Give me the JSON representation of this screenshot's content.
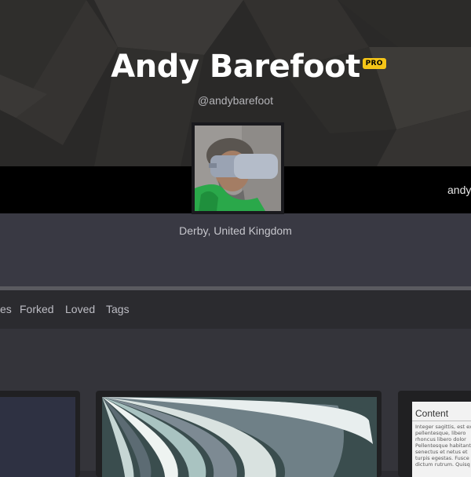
{
  "profile": {
    "name": "Andy Barefoot",
    "badge": "PRO",
    "handle": "@andybarefoot",
    "location": "Derby, United Kingdom",
    "bar_right_text": "andy"
  },
  "tabs": [
    {
      "label": "es"
    },
    {
      "label": "Forked"
    },
    {
      "label": "Loved"
    },
    {
      "label": "Tags"
    }
  ],
  "cards": {
    "third": {
      "title": "Content",
      "text": "Integer sagittis, est ex pellentesque, libero rhoncus libero dolor Pellentesque habitant senectus et netus et turpis egestas. Fusce dictum rutrum. Quisq"
    }
  },
  "icons": {
    "avatar": "user-avatar-vr-headset"
  }
}
